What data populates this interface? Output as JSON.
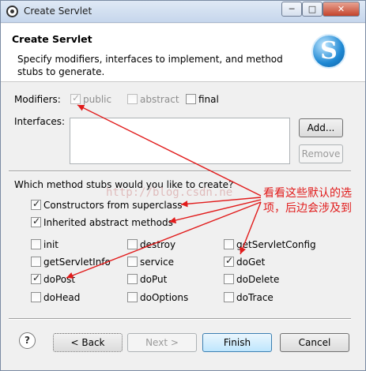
{
  "window": {
    "title": "Create Servlet",
    "min_glyph": "─",
    "max_glyph": "□",
    "close_glyph": "✕"
  },
  "header": {
    "title": "Create Servlet",
    "description": "Specify modifiers, interfaces to implement, and method stubs to generate.",
    "logo_letter": "S"
  },
  "modifiers": {
    "label": "Modifiers:",
    "public": {
      "label": "public",
      "checked": true,
      "enabled": false
    },
    "abstract": {
      "label": "abstract",
      "checked": false,
      "enabled": false
    },
    "final": {
      "label": "final",
      "checked": false,
      "enabled": true
    }
  },
  "interfaces": {
    "label": "Interfaces:",
    "add_label": "Add...",
    "remove_label": "Remove"
  },
  "stubs": {
    "question": "Which method stubs would you like to create?",
    "constructors": "Constructors from superclass",
    "inherited": "Inherited abstract methods",
    "methods": [
      "init",
      "destroy",
      "getServletConfig",
      "getServletInfo",
      "service",
      "doGet",
      "doPost",
      "doPut",
      "doDelete",
      "doHead",
      "doOptions",
      "doTrace"
    ],
    "checked": {
      "constructors": true,
      "inherited": true,
      "doGet": true,
      "doPost": true
    }
  },
  "watermark": "http://blog.csdn.ne",
  "annotation": "看看这些默认的选项，后边会涉及到",
  "footer": {
    "help": "?",
    "back_label": "< Back",
    "next_label": "Next >",
    "finish_label": "Finish",
    "cancel_label": "Cancel"
  },
  "colors": {
    "annotation": "#e11b1b",
    "accent": "#3c7fb1"
  }
}
